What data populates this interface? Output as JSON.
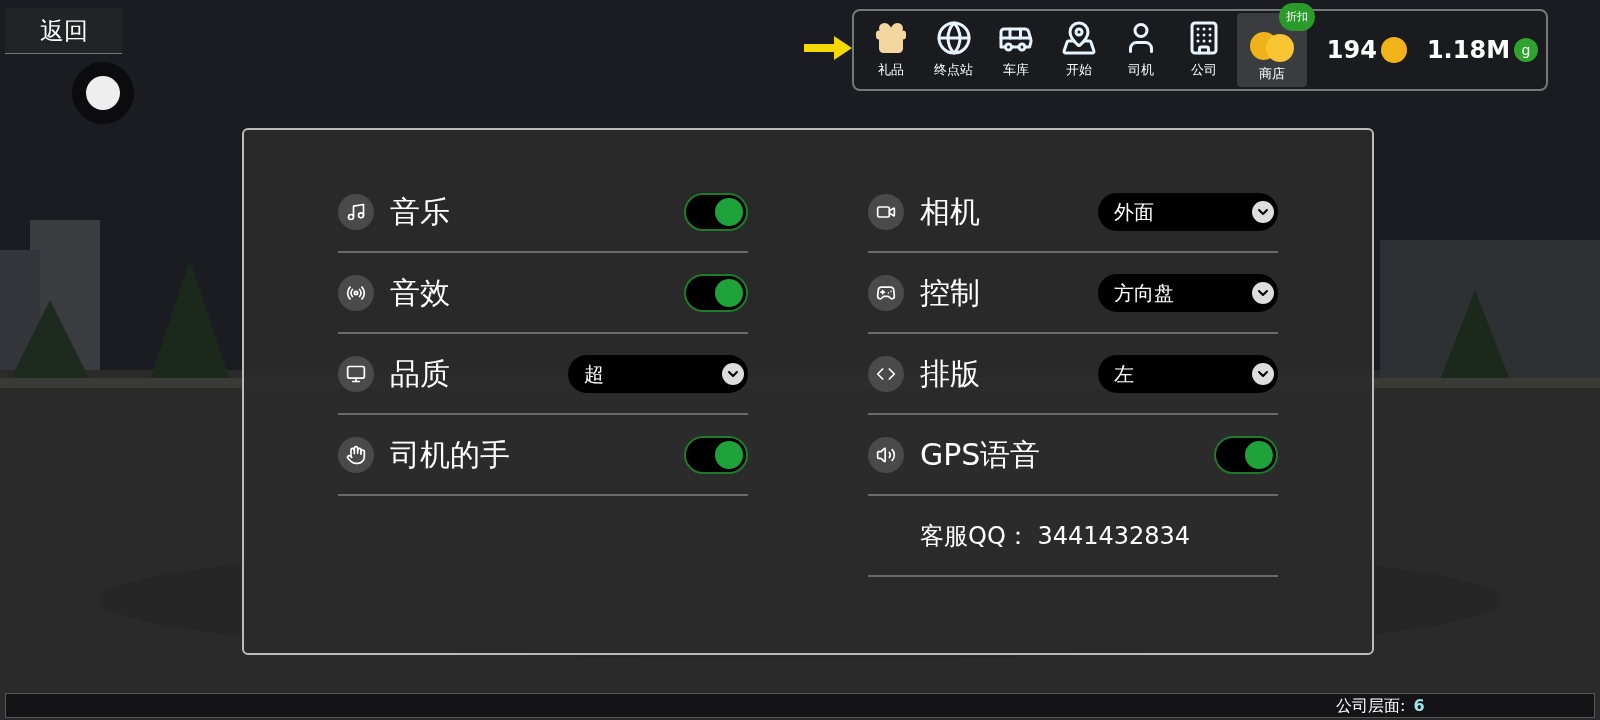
{
  "back_button": {
    "label": "返回"
  },
  "top_menu": [
    {
      "label": "礼品",
      "highlighted": true
    },
    {
      "label": "终点站",
      "highlighted": false
    },
    {
      "label": "车库",
      "highlighted": false
    },
    {
      "label": "开始",
      "highlighted": false
    },
    {
      "label": "司机",
      "highlighted": false
    },
    {
      "label": "公司",
      "highlighted": false
    }
  ],
  "shop": {
    "label": "商店",
    "badge": "折扣"
  },
  "currency": [
    {
      "amount": "194",
      "kind": "coin"
    },
    {
      "amount": "1.18M",
      "kind": "g",
      "symbol": "g"
    }
  ],
  "settings_left": [
    {
      "kind": "toggle",
      "label": "音乐",
      "on": true
    },
    {
      "kind": "toggle",
      "label": "音效",
      "on": true
    },
    {
      "kind": "select",
      "label": "品质",
      "value": "超"
    },
    {
      "kind": "toggle",
      "label": "司机的手",
      "on": true
    }
  ],
  "settings_right": [
    {
      "kind": "select",
      "label": "相机",
      "value": "外面"
    },
    {
      "kind": "select",
      "label": "控制",
      "value": "方向盘"
    },
    {
      "kind": "select",
      "label": "排版",
      "value": "左"
    },
    {
      "kind": "toggle",
      "label": "GPS语音",
      "on": true
    },
    {
      "kind": "info",
      "label": "客服QQ： 3441432834"
    }
  ],
  "status_bar": {
    "label": "公司层面:",
    "value": "6"
  }
}
